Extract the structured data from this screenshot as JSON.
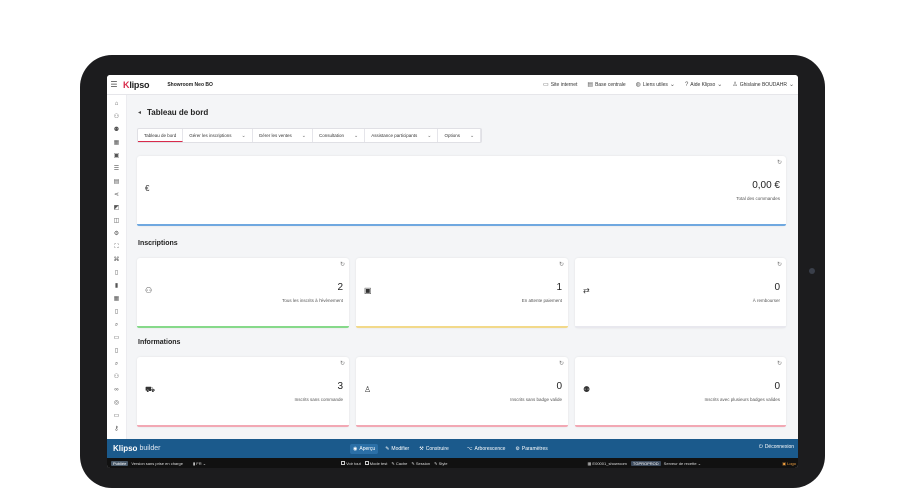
{
  "app": {
    "logo": "Klipso",
    "showroom": "Showroom Neo BO"
  },
  "topnav": {
    "site": "Site internet",
    "base": "Base centrale",
    "liens": "Liens utiles",
    "aide": "Aide Klipso",
    "user": "Ghislaine BOUDAHR"
  },
  "page": {
    "title": "Tableau de bord"
  },
  "tabs": [
    "Tableau de bord",
    "Gérer les inscriptions",
    "Gérer les ventes",
    "Consultation",
    "Assistance participants",
    "Options"
  ],
  "total": {
    "value": "0,00 €",
    "label": "Total des commandes"
  },
  "sections": {
    "inscriptions": "Inscriptions",
    "informations": "Informations"
  },
  "inscriptions": [
    {
      "value": "2",
      "label": "Tous les inscrits à l'évènement",
      "color": "#86d98a"
    },
    {
      "value": "1",
      "label": "En attente paiement",
      "color": "#f2d98a"
    },
    {
      "value": "0",
      "label": "À rembourser",
      "color": "#e8e8ee"
    }
  ],
  "informations": [
    {
      "value": "3",
      "label": "Inscrits sans commande",
      "color": "#f2a8b4"
    },
    {
      "value": "0",
      "label": "Inscrits sans badge valide",
      "color": "#f2a8b4"
    },
    {
      "value": "0",
      "label": "Inscrits avec plusieurs badges valides",
      "color": "#f2a8b4"
    }
  ],
  "builder": {
    "logo": "Klipso",
    "sub": "builder",
    "apercu": "Aperçu",
    "modifier": "Modifier",
    "construire": "Construire",
    "arbo": "Arborescence",
    "params": "Paramètres",
    "logout": "Déconnexion"
  },
  "status": {
    "publie": "Publiée",
    "version": "Version sans prise en charge",
    "lang": "FR",
    "voir": "Voir tout",
    "test": "Mode test",
    "cache": "Cache",
    "session": "Session",
    "style": "Style",
    "event": "E00001_showroom",
    "env": "TGPROPROD",
    "server": "Serveur de recette",
    "login": "Logo"
  },
  "colors": {
    "accent": "#d92b4b",
    "builder_bg": "#1b5a8c",
    "total_bar": "#6fa8e0"
  }
}
